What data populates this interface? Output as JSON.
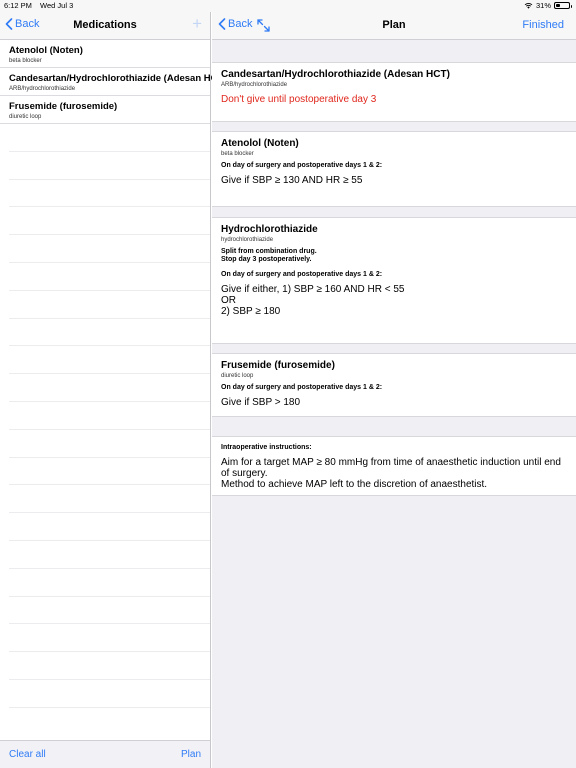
{
  "status": {
    "time": "6:12 PM",
    "date": "Wed Jul 3",
    "battery": "31%",
    "battery_level": 0.31
  },
  "left": {
    "back_label": "Back",
    "title": "Medications",
    "add_label": "+",
    "items": [
      {
        "name": "Atenolol (Noten)",
        "class": "beta blocker"
      },
      {
        "name": "Candesartan/Hydrochlorothiazide (Adesan HCT)",
        "class": "ARB/hydrochlorothiazide"
      },
      {
        "name": "Frusemide (furosemide)",
        "class": "diuretic loop"
      }
    ],
    "clear_label": "Clear all",
    "plan_label": "Plan"
  },
  "right": {
    "back_label": "Back",
    "title": "Plan",
    "finished_label": "Finished",
    "cards": [
      {
        "title": "Candesartan/Hydrochlorothiazide (Adesan HCT)",
        "sub": "ARB/hydrochlorothiazide",
        "note": "Don't give until postoperative day 3"
      },
      {
        "title": "Atenolol (Noten)",
        "sub": "beta blocker",
        "instruction": "On day of surgery and postoperative days 1 & 2:",
        "rule": "Give if SBP ≥ 130 AND HR ≥ 55"
      },
      {
        "title": "Hydrochlorothiazide",
        "sub": "hydrochlorothiazide",
        "split_1": "Split from combination drug.",
        "split_2": "Stop day 3 postoperatively.",
        "instruction": "On day of surgery and postoperative days 1 & 2:",
        "rule_1": "Give if either, 1) SBP ≥ 160 AND HR < 55",
        "rule_or": "OR",
        "rule_2": "2) SBP ≥ 180"
      },
      {
        "title": "Frusemide (furosemide)",
        "sub": "diuretic loop",
        "instruction": "On day of surgery and postoperative days 1 & 2:",
        "rule": "Give if SBP > 180"
      },
      {
        "instruction": "Intraoperative instructions:",
        "line_1": "Aim for a target MAP ≥ 80 mmHg from time of anaesthetic induction until end of surgery.",
        "line_2": "Method to achieve MAP left to the discretion of anaesthetist."
      }
    ]
  },
  "colors": {
    "accent": "#2f7bf6",
    "warning": "#e0271d",
    "background": "#efeff4"
  }
}
